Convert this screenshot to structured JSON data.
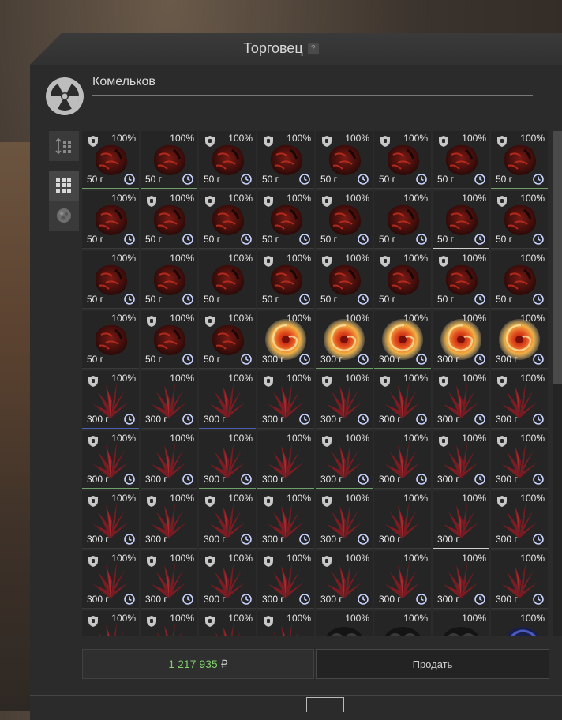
{
  "window": {
    "title": "Торговец",
    "help_label": "?"
  },
  "trader": {
    "name": "Комельков",
    "icon": "radiation-icon"
  },
  "side_tabs": [
    {
      "name": "sort-icon",
      "active": false
    },
    {
      "name": "grid-view-icon",
      "active": true
    },
    {
      "name": "artifact-filter-icon",
      "active": false
    }
  ],
  "grid": {
    "columns": 8,
    "rows": [
      [
        {
          "pct": "100%",
          "price": "50 г",
          "type": "rock",
          "shield": true,
          "clock": true,
          "q": "green"
        },
        {
          "pct": "100%",
          "price": "50 г",
          "type": "rock",
          "shield": false,
          "clock": true,
          "q": "green"
        },
        {
          "pct": "100%",
          "price": "50 г",
          "type": "rock",
          "shield": true,
          "clock": true,
          "q": "none"
        },
        {
          "pct": "100%",
          "price": "50 г",
          "type": "rock",
          "shield": true,
          "clock": true,
          "q": "none"
        },
        {
          "pct": "100%",
          "price": "50 г",
          "type": "rock",
          "shield": true,
          "clock": true,
          "q": "none"
        },
        {
          "pct": "100%",
          "price": "50 г",
          "type": "rock",
          "shield": true,
          "clock": true,
          "q": "none"
        },
        {
          "pct": "100%",
          "price": "50 г",
          "type": "rock",
          "shield": true,
          "clock": true,
          "q": "none"
        },
        {
          "pct": "100%",
          "price": "50 г",
          "type": "rock",
          "shield": true,
          "clock": true,
          "q": "green"
        }
      ],
      [
        {
          "pct": "100%",
          "price": "50 г",
          "type": "rock",
          "shield": false,
          "clock": true,
          "q": "none"
        },
        {
          "pct": "100%",
          "price": "50 г",
          "type": "rock",
          "shield": true,
          "clock": true,
          "q": "none"
        },
        {
          "pct": "100%",
          "price": "50 г",
          "type": "rock",
          "shield": true,
          "clock": true,
          "q": "none"
        },
        {
          "pct": "100%",
          "price": "50 г",
          "type": "rock",
          "shield": true,
          "clock": true,
          "q": "none"
        },
        {
          "pct": "100%",
          "price": "50 г",
          "type": "rock",
          "shield": true,
          "clock": true,
          "q": "none"
        },
        {
          "pct": "100%",
          "price": "50 г",
          "type": "rock",
          "shield": false,
          "clock": true,
          "q": "none"
        },
        {
          "pct": "100%",
          "price": "50 г",
          "type": "rock",
          "shield": false,
          "clock": true,
          "q": "white"
        },
        {
          "pct": "100%",
          "price": "50 г",
          "type": "rock",
          "shield": true,
          "clock": true,
          "q": "none"
        }
      ],
      [
        {
          "pct": "100%",
          "price": "50 г",
          "type": "rock",
          "shield": false,
          "clock": true,
          "q": "none"
        },
        {
          "pct": "100%",
          "price": "50 г",
          "type": "rock",
          "shield": false,
          "clock": true,
          "q": "none"
        },
        {
          "pct": "100%",
          "price": "50 г",
          "type": "rock",
          "shield": false,
          "clock": false,
          "q": "none"
        },
        {
          "pct": "100%",
          "price": "50 г",
          "type": "rock",
          "shield": true,
          "clock": true,
          "q": "none"
        },
        {
          "pct": "100%",
          "price": "50 г",
          "type": "rock",
          "shield": true,
          "clock": true,
          "q": "none"
        },
        {
          "pct": "100%",
          "price": "50 г",
          "type": "rock",
          "shield": true,
          "clock": false,
          "q": "none"
        },
        {
          "pct": "100%",
          "price": "50 г",
          "type": "rock",
          "shield": true,
          "clock": true,
          "q": "none"
        },
        {
          "pct": "100%",
          "price": "50 г",
          "type": "rock",
          "shield": false,
          "clock": true,
          "q": "none"
        }
      ],
      [
        {
          "pct": "100%",
          "price": "50 г",
          "type": "rock",
          "shield": false,
          "clock": false,
          "q": "none"
        },
        {
          "pct": "100%",
          "price": "50 г",
          "type": "rock",
          "shield": true,
          "clock": true,
          "q": "none"
        },
        {
          "pct": "100%",
          "price": "50 г",
          "type": "rock",
          "shield": true,
          "clock": true,
          "q": "none"
        },
        {
          "pct": "100%",
          "price": "300 г",
          "type": "swirl",
          "shield": false,
          "clock": true,
          "q": "none"
        },
        {
          "pct": "100%",
          "price": "300 г",
          "type": "swirl",
          "shield": false,
          "clock": true,
          "q": "green"
        },
        {
          "pct": "100%",
          "price": "300 г",
          "type": "swirl",
          "shield": false,
          "clock": true,
          "q": "green"
        },
        {
          "pct": "100%",
          "price": "300 г",
          "type": "swirl",
          "shield": false,
          "clock": true,
          "q": "none"
        },
        {
          "pct": "100%",
          "price": "300 г",
          "type": "swirl",
          "shield": false,
          "clock": true,
          "q": "none"
        }
      ],
      [
        {
          "pct": "100%",
          "price": "300 г",
          "type": "crystal",
          "shield": true,
          "clock": true,
          "q": "blue"
        },
        {
          "pct": "100%",
          "price": "300 г",
          "type": "crystal",
          "shield": false,
          "clock": true,
          "q": "none"
        },
        {
          "pct": "100%",
          "price": "300 г",
          "type": "crystal",
          "shield": false,
          "clock": false,
          "q": "blue"
        },
        {
          "pct": "100%",
          "price": "300 г",
          "type": "crystal",
          "shield": true,
          "clock": true,
          "q": "none"
        },
        {
          "pct": "100%",
          "price": "300 г",
          "type": "crystal",
          "shield": true,
          "clock": true,
          "q": "none"
        },
        {
          "pct": "100%",
          "price": "300 г",
          "type": "crystal",
          "shield": true,
          "clock": true,
          "q": "none"
        },
        {
          "pct": "100%",
          "price": "300 г",
          "type": "crystal",
          "shield": true,
          "clock": true,
          "q": "none"
        },
        {
          "pct": "100%",
          "price": "300 г",
          "type": "crystal",
          "shield": true,
          "clock": true,
          "q": "none"
        }
      ],
      [
        {
          "pct": "100%",
          "price": "300 г",
          "type": "crystal",
          "shield": true,
          "clock": true,
          "q": "green"
        },
        {
          "pct": "100%",
          "price": "300 г",
          "type": "crystal",
          "shield": false,
          "clock": true,
          "q": "none"
        },
        {
          "pct": "100%",
          "price": "300 г",
          "type": "crystal",
          "shield": false,
          "clock": true,
          "q": "green"
        },
        {
          "pct": "100%",
          "price": "300 г",
          "type": "crystal",
          "shield": false,
          "clock": false,
          "q": "green"
        },
        {
          "pct": "100%",
          "price": "300 г",
          "type": "crystal",
          "shield": true,
          "clock": true,
          "q": "green"
        },
        {
          "pct": "100%",
          "price": "300 г",
          "type": "crystal",
          "shield": false,
          "clock": true,
          "q": "none"
        },
        {
          "pct": "100%",
          "price": "300 г",
          "type": "crystal",
          "shield": true,
          "clock": true,
          "q": "none"
        },
        {
          "pct": "100%",
          "price": "300 г",
          "type": "crystal",
          "shield": true,
          "clock": true,
          "q": "none"
        }
      ],
      [
        {
          "pct": "100%",
          "price": "300 г",
          "type": "crystal",
          "shield": true,
          "clock": true,
          "q": "none"
        },
        {
          "pct": "100%",
          "price": "300 г",
          "type": "crystal",
          "shield": true,
          "clock": false,
          "q": "none"
        },
        {
          "pct": "100%",
          "price": "300 г",
          "type": "crystal",
          "shield": true,
          "clock": true,
          "q": "none"
        },
        {
          "pct": "100%",
          "price": "300 г",
          "type": "crystal",
          "shield": true,
          "clock": true,
          "q": "none"
        },
        {
          "pct": "100%",
          "price": "300 г",
          "type": "crystal",
          "shield": true,
          "clock": true,
          "q": "none"
        },
        {
          "pct": "100%",
          "price": "300 г",
          "type": "crystal",
          "shield": false,
          "clock": false,
          "q": "none"
        },
        {
          "pct": "100%",
          "price": "300 г",
          "type": "crystal",
          "shield": false,
          "clock": false,
          "q": "white"
        },
        {
          "pct": "100%",
          "price": "300 г",
          "type": "crystal",
          "shield": true,
          "clock": true,
          "q": "none"
        }
      ],
      [
        {
          "pct": "100%",
          "price": "300 г",
          "type": "crystal",
          "shield": true,
          "clock": true,
          "q": "none"
        },
        {
          "pct": "100%",
          "price": "300 г",
          "type": "crystal",
          "shield": true,
          "clock": true,
          "q": "none"
        },
        {
          "pct": "100%",
          "price": "300 г",
          "type": "crystal",
          "shield": true,
          "clock": true,
          "q": "none"
        },
        {
          "pct": "100%",
          "price": "300 г",
          "type": "crystal",
          "shield": true,
          "clock": true,
          "q": "none"
        },
        {
          "pct": "100%",
          "price": "300 г",
          "type": "crystal",
          "shield": true,
          "clock": true,
          "q": "none"
        },
        {
          "pct": "100%",
          "price": "300 г",
          "type": "crystal",
          "shield": false,
          "clock": true,
          "q": "none"
        },
        {
          "pct": "100%",
          "price": "300 г",
          "type": "crystal",
          "shield": false,
          "clock": true,
          "q": "none"
        },
        {
          "pct": "100%",
          "price": "300 г",
          "type": "crystal",
          "shield": false,
          "clock": true,
          "q": "none"
        }
      ],
      [
        {
          "pct": "100%",
          "price": "",
          "type": "crystal",
          "shield": true,
          "clock": false,
          "q": "none"
        },
        {
          "pct": "100%",
          "price": "",
          "type": "crystal",
          "shield": true,
          "clock": false,
          "q": "none"
        },
        {
          "pct": "100%",
          "price": "",
          "type": "crystal",
          "shield": true,
          "clock": false,
          "q": "none"
        },
        {
          "pct": "100%",
          "price": "",
          "type": "crystal",
          "shield": true,
          "clock": false,
          "q": "none"
        },
        {
          "pct": "100%",
          "price": "",
          "type": "dark",
          "shield": false,
          "clock": false,
          "q": "none"
        },
        {
          "pct": "100%",
          "price": "",
          "type": "dark",
          "shield": false,
          "clock": false,
          "q": "none"
        },
        {
          "pct": "100%",
          "price": "",
          "type": "dark",
          "shield": false,
          "clock": false,
          "q": "none"
        },
        {
          "pct": "100%",
          "price": "",
          "type": "darkblue",
          "shield": false,
          "clock": false,
          "q": "none"
        }
      ]
    ]
  },
  "footer": {
    "balance": "1 217 935",
    "currency": "₽",
    "sell_label": "Продать"
  },
  "colors": {
    "balance": "#7fd16a",
    "quality_green": "#6f9f6a",
    "quality_blue": "#4b5fb0"
  }
}
